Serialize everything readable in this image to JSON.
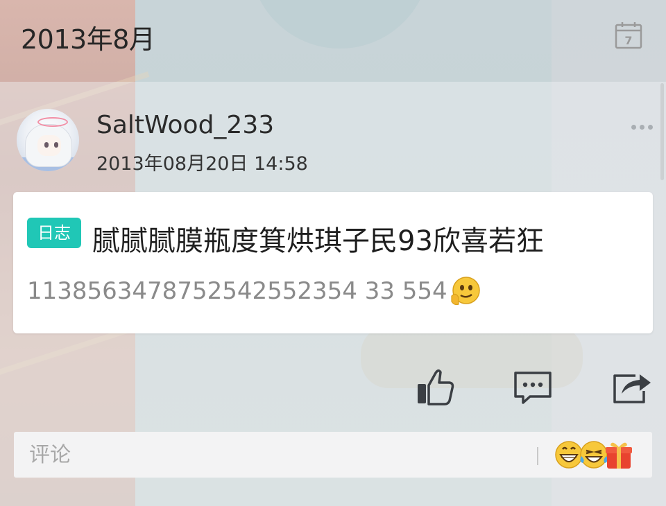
{
  "header": {
    "title": "2013年8月",
    "calendar_icon": "calendar-icon",
    "calendar_day": "7"
  },
  "post": {
    "username": "SaltWood_233",
    "timestamp": "2013年08月20日 14:58",
    "more_icon": "more-dots-icon",
    "card": {
      "tag": "日志",
      "tag_color": "#20c7b6",
      "title": "腻腻腻膜瓶度箕烘琪子民93欣喜若狂",
      "body": "1138563478752542552354 33 554",
      "body_emoji": "thinking-emoji-icon"
    },
    "actions": {
      "like_icon": "thumbs-up-icon",
      "comment_icon": "comment-icon",
      "share_icon": "share-icon"
    }
  },
  "comment_bar": {
    "placeholder": "评论",
    "emojis": [
      "grinning-emoji-icon",
      "laughing-tears-emoji-icon",
      "gift-emoji-icon"
    ]
  }
}
